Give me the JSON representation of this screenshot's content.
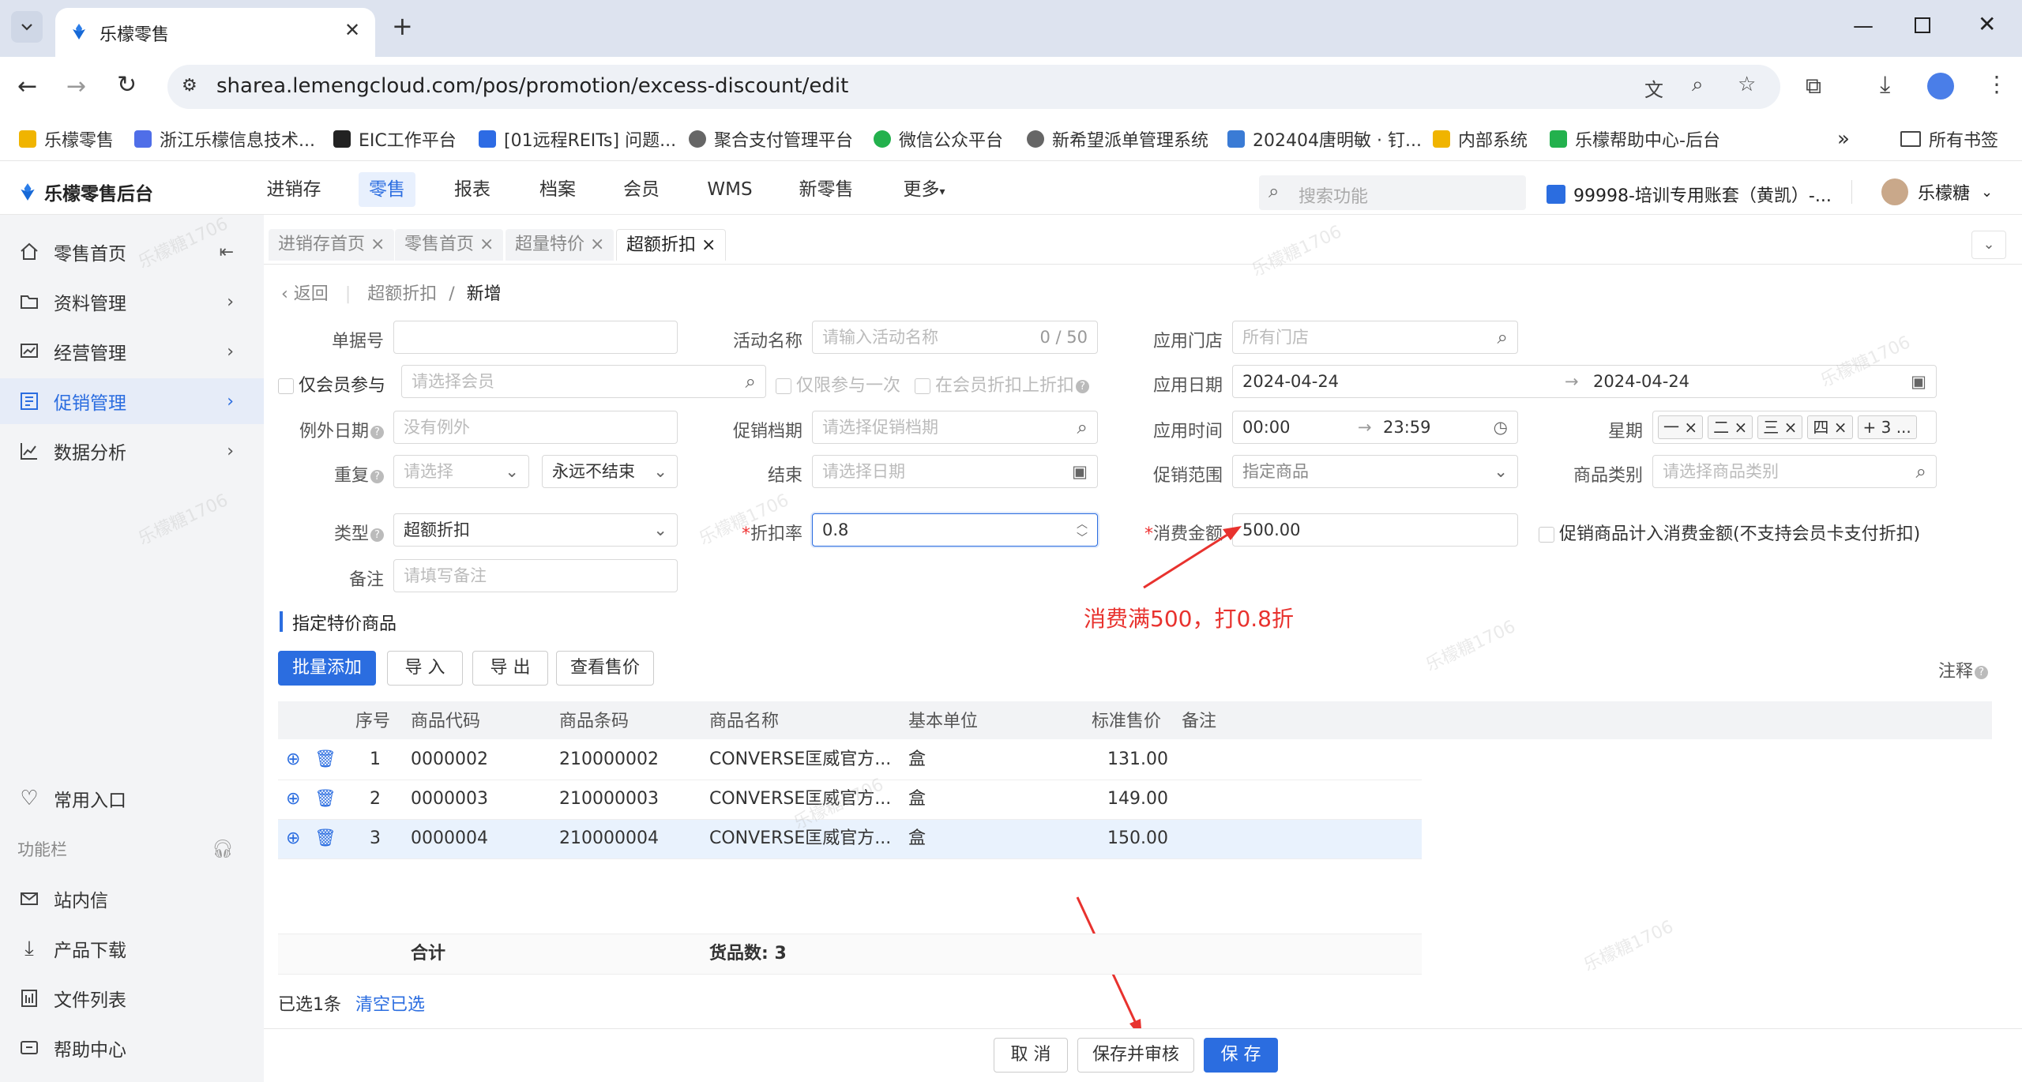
{
  "browser": {
    "tab_title": "乐檬零售",
    "url": "sharea.lemengcloud.com/pos/promotion/excess-discount/edit",
    "bookmarks": [
      "乐檬零售",
      "浙江乐檬信息技术...",
      "EIC工作平台",
      "[01远程REITs] 问题...",
      "聚合支付管理平台",
      "微信公众平台",
      "新希望派单管理系统",
      "202404唐明敏 · 钉...",
      "内部系统",
      "乐檬帮助中心-后台"
    ],
    "all_bookmarks": "所有书签"
  },
  "header": {
    "logo": "乐檬零售后台",
    "nav": [
      "进销存",
      "零售",
      "报表",
      "档案",
      "会员",
      "WMS",
      "新零售",
      "更多"
    ],
    "search_placeholder": "搜索功能",
    "account": "99998-培训专用账套（黄凯）-...",
    "user": "乐檬糖"
  },
  "sidebar": {
    "items": [
      "零售首页",
      "资料管理",
      "经营管理",
      "促销管理",
      "数据分析"
    ],
    "bottom": [
      "常用入口",
      "功能栏",
      "站内信",
      "产品下载",
      "文件列表",
      "帮助中心"
    ]
  },
  "page_tabs": [
    "进销存首页",
    "零售首页",
    "超量特价",
    "超额折扣"
  ],
  "breadcrumb": {
    "back": "返回",
    "parent": "超额折扣",
    "current": "新增"
  },
  "form": {
    "doc_no_label": "单据号",
    "activity_label": "活动名称",
    "activity_placeholder": "请输入活动名称",
    "activity_count": "0 / 50",
    "store_label": "应用门店",
    "store_placeholder": "所有门店",
    "member_only_label": "仅会员参与",
    "member_placeholder": "请选择会员",
    "once_only": "仅限参与一次",
    "member_discount": "在会员折扣上折扣",
    "date_label": "应用日期",
    "date_start": "2024-04-24",
    "date_end": "2024-04-24",
    "except_label": "例外日期",
    "except_placeholder": "没有例外",
    "archive_label": "促销档期",
    "archive_placeholder": "请选择促销档期",
    "time_label": "应用时间",
    "time_start": "00:00",
    "time_end": "23:59",
    "week_label": "星期",
    "week_tags": [
      "一",
      "二",
      "三",
      "四"
    ],
    "week_more": "+ 3 ...",
    "repeat_label": "重复",
    "repeat_placeholder": "请选择",
    "repeat_end": "永远不结束",
    "end_label": "结束",
    "end_placeholder": "请选择日期",
    "scope_label": "促销范围",
    "scope_value": "指定商品",
    "category_label": "商品类别",
    "category_placeholder": "请选择商品类别",
    "type_label": "类型",
    "type_value": "超额折扣",
    "rate_label": "折扣率",
    "rate_value": "0.8",
    "amount_label": "消费金额",
    "amount_value": "500.00",
    "include_label": "促销商品计入消费金额(不支持会员卡支付折扣)",
    "remark_label": "备注",
    "remark_placeholder": "请填写备注"
  },
  "annotation_text": "消费满500，打0.8折",
  "section_title": "指定特价商品",
  "buttons": {
    "batch_add": "批量添加",
    "import": "导 入",
    "export": "导 出",
    "view_price": "查看售价",
    "note": "注释",
    "cancel": "取 消",
    "save_audit": "保存并审核",
    "save": "保 存",
    "clear": "清空已选"
  },
  "table": {
    "headers": [
      "序号",
      "商品代码",
      "商品条码",
      "商品名称",
      "基本单位",
      "标准售价",
      "备注"
    ],
    "rows": [
      {
        "no": "1",
        "code": "0000002",
        "barcode": "210000002",
        "name": "CONVERSE匡威官方...",
        "unit": "盒",
        "price": "131.00"
      },
      {
        "no": "2",
        "code": "0000003",
        "barcode": "210000003",
        "name": "CONVERSE匡威官方...",
        "unit": "盒",
        "price": "149.00"
      },
      {
        "no": "3",
        "code": "0000004",
        "barcode": "210000004",
        "name": "CONVERSE匡威官方...",
        "unit": "盒",
        "price": "150.00"
      }
    ],
    "total_label": "合计",
    "goods_count": "货品数: 3"
  },
  "selected_text": "已选1条",
  "watermark": "乐檬糖1706",
  "colors": {
    "primary": "#2b6de0",
    "annotation": "#e8322e"
  }
}
